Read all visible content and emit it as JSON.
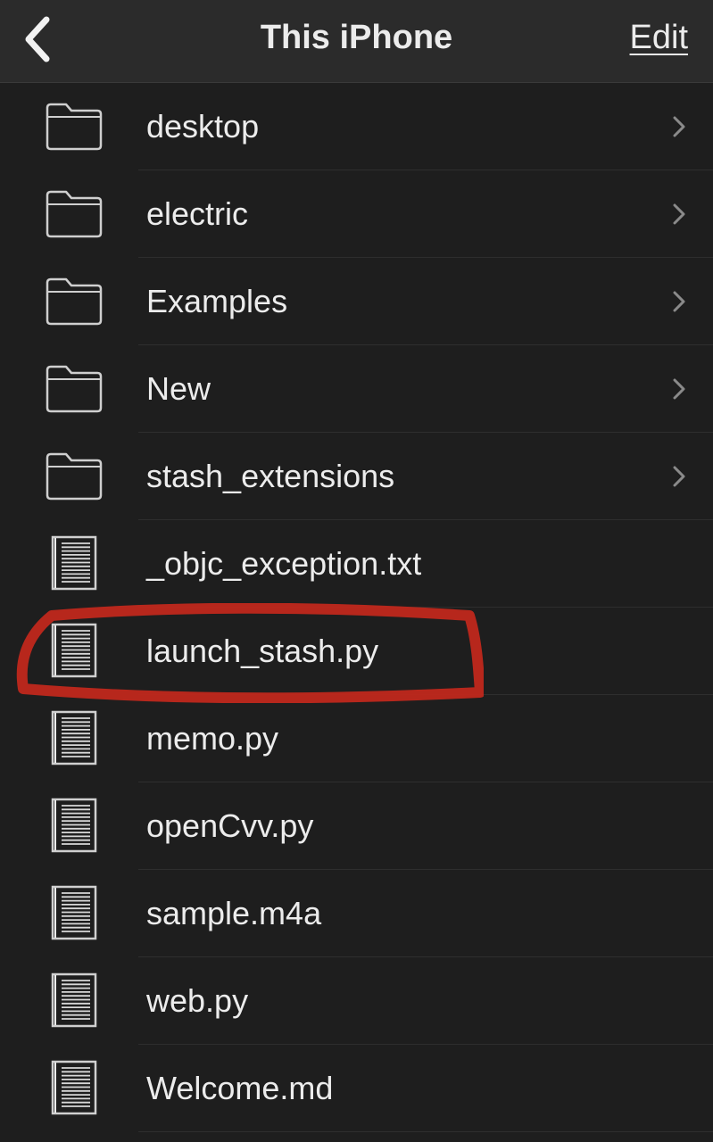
{
  "navbar": {
    "title": "This iPhone",
    "edit_label": "Edit",
    "back_icon": "chevron-left-icon"
  },
  "items": [
    {
      "name": "desktop",
      "type": "folder",
      "icon": "folder-icon"
    },
    {
      "name": "electric",
      "type": "folder",
      "icon": "folder-icon"
    },
    {
      "name": "Examples",
      "type": "folder",
      "icon": "folder-icon"
    },
    {
      "name": "New",
      "type": "folder",
      "icon": "folder-icon"
    },
    {
      "name": "stash_extensions",
      "type": "folder",
      "icon": "folder-icon"
    },
    {
      "name": "_objc_exception.txt",
      "type": "file",
      "icon": "document-icon"
    },
    {
      "name": "launch_stash.py",
      "type": "file",
      "icon": "document-icon"
    },
    {
      "name": "memo.py",
      "type": "file",
      "icon": "document-icon"
    },
    {
      "name": "openCvv.py",
      "type": "file",
      "icon": "document-icon"
    },
    {
      "name": "sample.m4a",
      "type": "file",
      "icon": "document-icon"
    },
    {
      "name": "web.py",
      "type": "file",
      "icon": "document-icon"
    },
    {
      "name": "Welcome.md",
      "type": "file",
      "icon": "document-icon"
    }
  ],
  "annotation": {
    "highlighted_item": "launch_stash.py",
    "color": "#c0281c"
  },
  "colors": {
    "background": "#1e1e1e",
    "navbar": "#2b2b2b",
    "text": "#ececec",
    "chevron": "#8a8a8a"
  }
}
